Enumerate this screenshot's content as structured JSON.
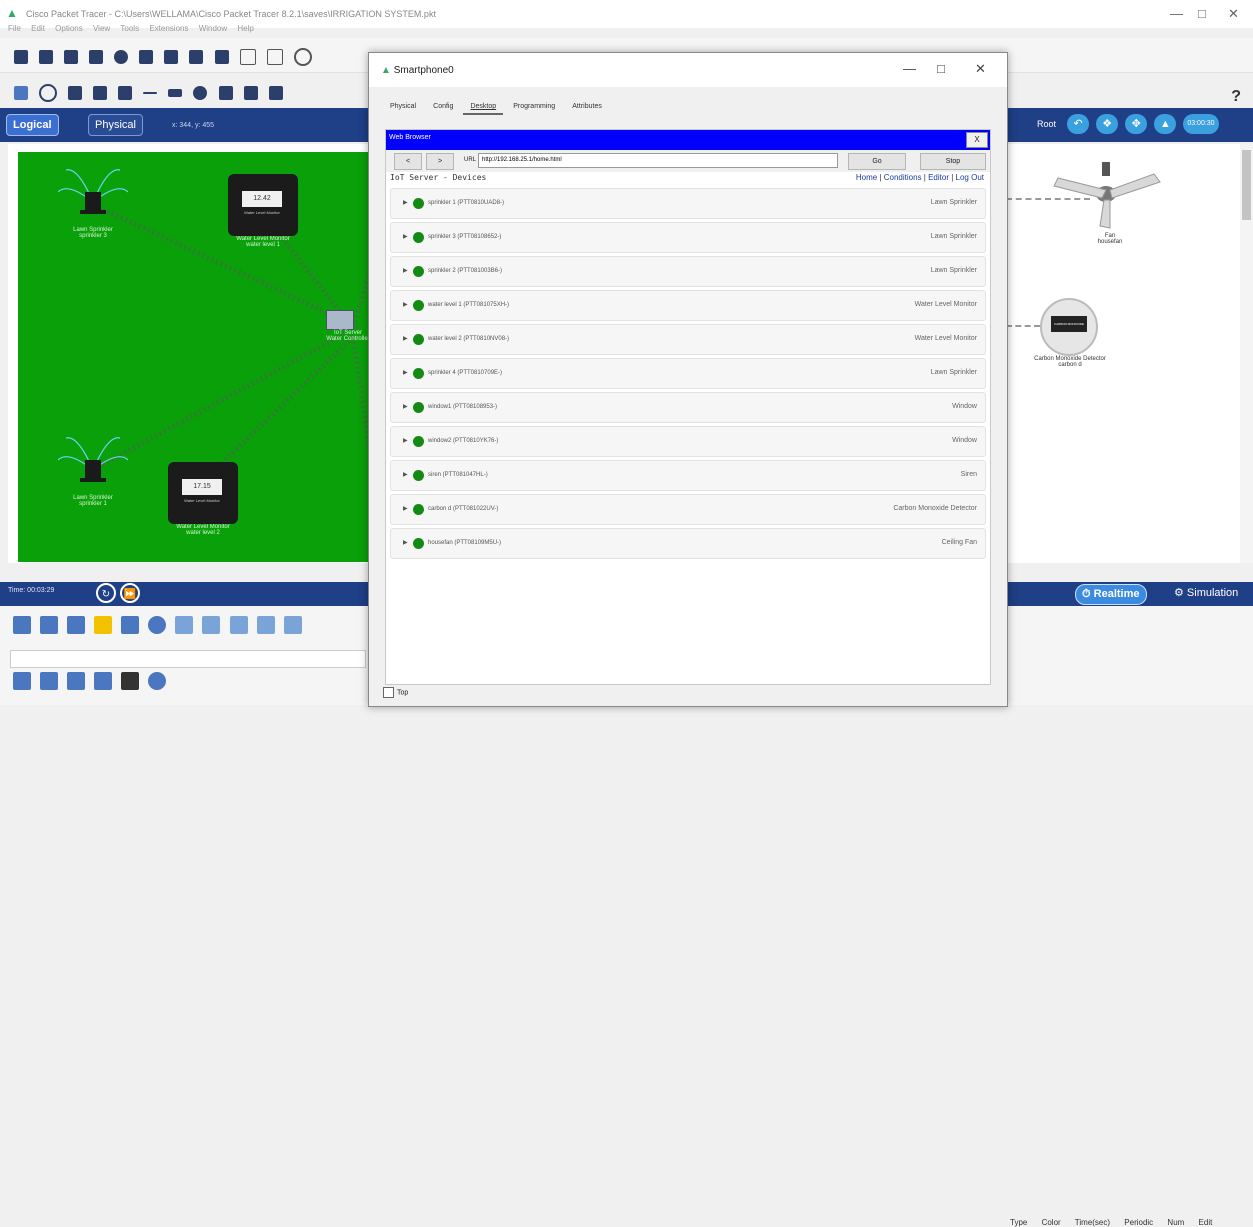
{
  "app": {
    "title": "Cisco Packet Tracer - C:\\Users\\WELLAMA\\Cisco Packet Tracer 8.2.1\\saves\\IRRIGATION SYSTEM.pkt",
    "menu": [
      "File",
      "Edit",
      "Options",
      "View",
      "Tools",
      "Extensions",
      "Window",
      "Help"
    ],
    "help_icon": "?"
  },
  "workspace": {
    "logical_tab": "Logical",
    "physical_tab": "Physical",
    "coords": "x: 344, y: 455",
    "root_label": "Root",
    "clock": "03:00:30"
  },
  "canvas_devices": {
    "sprinkler3": [
      "Lawn Sprinkler",
      "sprinkler 3"
    ],
    "sprinkler1": [
      "Lawn Sprinkler",
      "sprinkler 1"
    ],
    "monitor1": {
      "reading": "12.42",
      "tag": "Water Level Monitor",
      "label": [
        "Water Level Monitor",
        "water level 1"
      ]
    },
    "monitor2": {
      "reading": "17.15",
      "tag": "Water Level Monitor",
      "label": [
        "Water Level Monitor",
        "water level 2"
      ]
    },
    "server": [
      "IoT Server",
      "Water Controller"
    ],
    "fan": [
      "Fan",
      "housefan"
    ],
    "co": {
      "badge": "CARBON MONOXIDE ALARM",
      "label": [
        "Carbon Monoxide Detector",
        "carbon d"
      ]
    }
  },
  "timebar": {
    "time": "Time: 00:03:29",
    "realtime": "Realtime",
    "simulation": "Simulation"
  },
  "event_table": [
    "Type",
    "Color",
    "Time(sec)",
    "Periodic",
    "Num",
    "Edit"
  ],
  "dialog": {
    "title": "Smartphone0",
    "tabs": [
      "Physical",
      "Config",
      "Desktop",
      "Programming",
      "Attributes"
    ],
    "browser": {
      "header": "Web Browser",
      "close": "X",
      "back": "<",
      "forward": ">",
      "url_label": "URL",
      "url": "http://192.168.25.1/home.html",
      "go": "Go",
      "stop": "Stop"
    },
    "iot": {
      "title": "IoT Server - Devices",
      "links": [
        "Home",
        "Conditions",
        "Editor",
        "Log Out"
      ],
      "devices": [
        {
          "name": "sprinkler 1 (PTT0810UAD8-)",
          "type": "Lawn Sprinkler"
        },
        {
          "name": "sprinkler 3 (PTT08108652-)",
          "type": "Lawn Sprinkler"
        },
        {
          "name": "sprinkler 2 (PTT081003B6-)",
          "type": "Lawn Sprinkler"
        },
        {
          "name": "water level 1 (PTT081075XH-)",
          "type": "Water Level Monitor"
        },
        {
          "name": "water level 2 (PTT0810NV08-)",
          "type": "Water Level Monitor"
        },
        {
          "name": "sprinkler 4 (PTT0810709E-)",
          "type": "Lawn Sprinkler"
        },
        {
          "name": "window1 (PTT08108953-)",
          "type": "Window"
        },
        {
          "name": "window2 (PTT0810YK76-)",
          "type": "Window"
        },
        {
          "name": "siren (PTT081047HL-)",
          "type": "Siren"
        },
        {
          "name": "carbon d (PTT081022UV-)",
          "type": "Carbon Monoxide Detector"
        },
        {
          "name": "housefan (PTT08109M5U-)",
          "type": "Ceiling Fan"
        }
      ]
    },
    "top_checkbox": "Top"
  }
}
